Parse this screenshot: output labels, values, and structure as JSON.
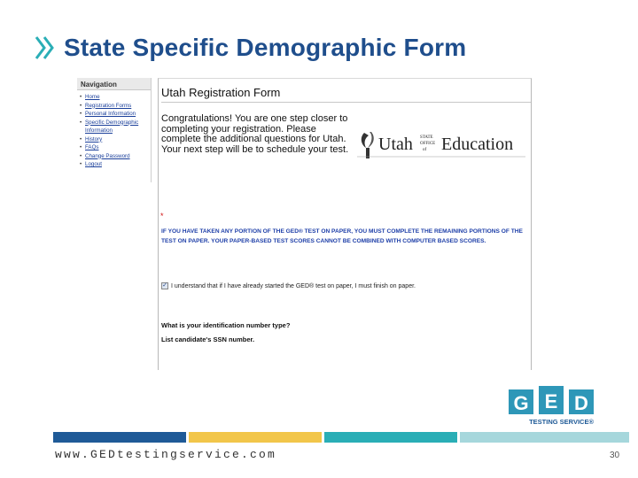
{
  "slide": {
    "title": "State Specific Demographic Form",
    "footer_url": "www.GEDtestingservice.com",
    "page_number": "30"
  },
  "nav": {
    "title": "Navigation",
    "items": [
      {
        "label": "Home"
      },
      {
        "label": "Registration Forms"
      },
      {
        "label": "Personal Information"
      },
      {
        "label": "Specific Demographic"
      },
      {
        "label": "Information",
        "continuation": true
      },
      {
        "label": "History"
      },
      {
        "label": "FAQs"
      },
      {
        "label": "Change Password"
      },
      {
        "label": "Logout"
      }
    ]
  },
  "form": {
    "title": "Utah Registration Form",
    "congrats": "Congratulations! You are one step closer to completing your registration. Please complete the additional questions for Utah. Your next step will be to schedule your test.",
    "required_marker": "*",
    "warning": "IF YOU HAVE TAKEN ANY PORTION OF THE GED® TEST ON PAPER, YOU MUST COMPLETE THE REMAINING PORTIONS OF THE TEST ON PAPER. YOUR PAPER-BASED TEST SCORES CANNOT BE COMBINED WITH COMPUTER BASED SCORES.",
    "acknowledgement": "I understand that if I have already started the GED® test on paper, I must finish on paper.",
    "acknowledgement_checked": true,
    "question_id_type": "What is your identification number type?",
    "question_ssn": "List candidate's SSN number."
  },
  "utah_logo": {
    "word_utah": "Utah",
    "word_state": "STATE",
    "word_office": "OFFICE",
    "word_of": "of",
    "word_education": "Education"
  },
  "ged_logo": {
    "letters": [
      "G",
      "E",
      "D"
    ],
    "tagline": "TESTING SERVICE®"
  },
  "colors": {
    "title_blue": "#1f4e8c",
    "bar_navy": "#1f5a97",
    "bar_gold": "#f2c64a",
    "bar_teal": "#2aaeb6",
    "bar_light_teal": "#a6d7dc",
    "ged_teal": "#2e97b8",
    "warning_blue": "#1e3fa8"
  }
}
